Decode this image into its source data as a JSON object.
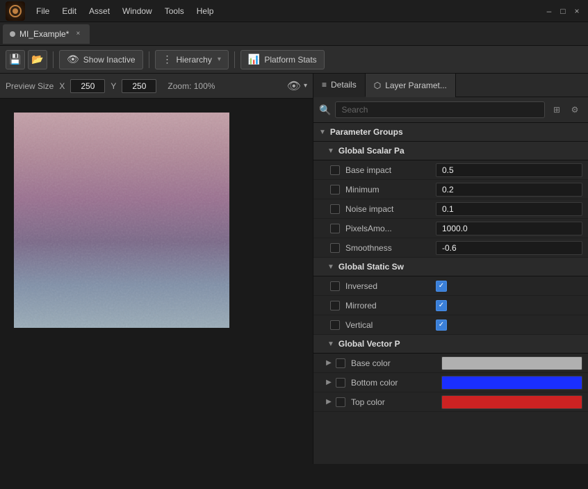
{
  "titlebar": {
    "menu": [
      "File",
      "Edit",
      "Asset",
      "Window",
      "Tools",
      "Help"
    ],
    "tab_name": "MI_Example*",
    "close_label": "×",
    "minimize_label": "–",
    "maximize_label": "□"
  },
  "toolbar": {
    "save_icon": "💾",
    "open_icon": "📂",
    "show_inactive_label": "Show Inactive",
    "hierarchy_label": "Hierarchy",
    "platform_stats_label": "Platform Stats",
    "hierarchy_arrow": "▾"
  },
  "preview": {
    "size_label": "Preview Size",
    "x_label": "X",
    "y_label": "Y",
    "x_value": "250",
    "y_value": "250",
    "zoom_label": "Zoom: 100%"
  },
  "details_panel": {
    "tabs": [
      {
        "id": "details",
        "label": "Details",
        "active": true,
        "icon": "≡"
      },
      {
        "id": "layer_params",
        "label": "Layer Paramet...",
        "active": false,
        "icon": "⬡"
      }
    ],
    "search_placeholder": "Search",
    "view_toggle_icon": "⊞",
    "settings_icon": "⚙"
  },
  "sections": [
    {
      "id": "parameter_groups",
      "label": "Parameter Groups",
      "expanded": true
    },
    {
      "id": "global_scalar",
      "label": "Global Scalar Pa",
      "expanded": true,
      "properties": [
        {
          "name": "Base impact",
          "value": "0.5"
        },
        {
          "name": "Minimum",
          "value": "0.2"
        },
        {
          "name": "Noise impact",
          "value": "0.1"
        },
        {
          "name": "PixelsAmo...",
          "value": "1000.0"
        },
        {
          "name": "Smoothness",
          "value": "-0.6"
        }
      ]
    },
    {
      "id": "global_static_sw",
      "label": "Global Static Sw",
      "expanded": true,
      "booleans": [
        {
          "name": "Inversed",
          "checked": true
        },
        {
          "name": "Mirrored",
          "checked": true
        },
        {
          "name": "Vertical",
          "checked": true
        }
      ]
    },
    {
      "id": "global_vector",
      "label": "Global Vector P",
      "expanded": true,
      "colors": [
        {
          "name": "Base color",
          "color": "#b0b0b0"
        },
        {
          "name": "Bottom color",
          "color": "#1a2fff"
        },
        {
          "name": "Top color",
          "color": "#cc2222"
        }
      ]
    }
  ]
}
